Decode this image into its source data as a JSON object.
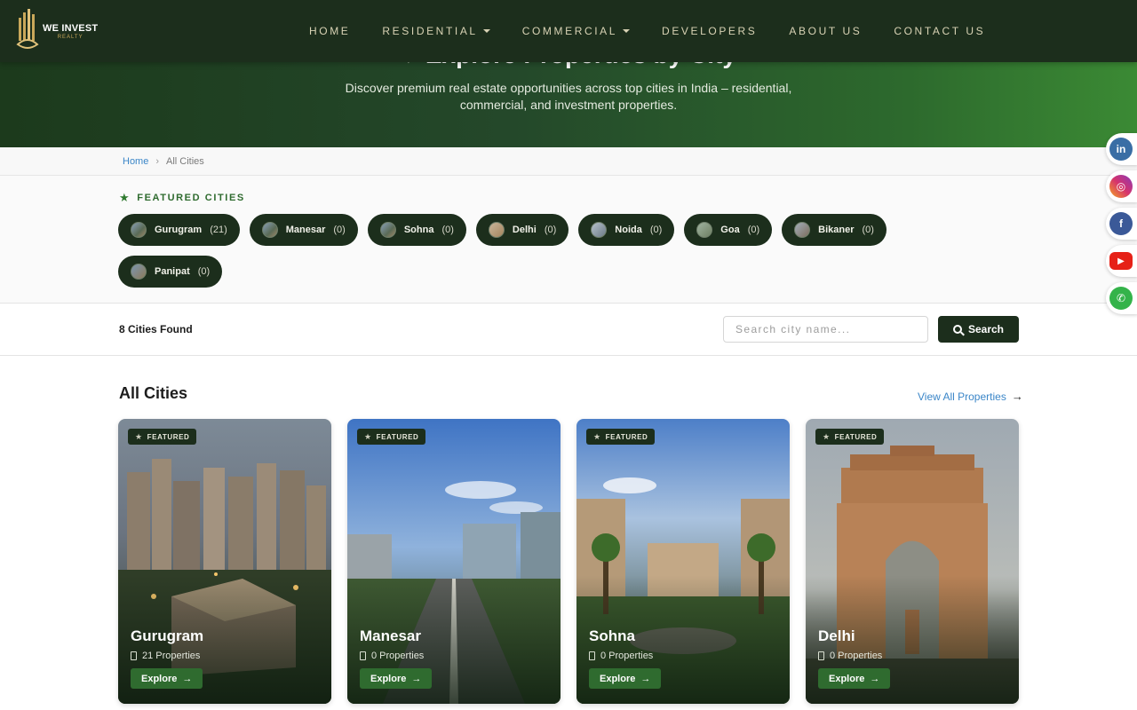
{
  "brand": {
    "name": "WE INVEST",
    "tagline": "REALTY"
  },
  "nav": {
    "items": [
      {
        "label": "HOME",
        "dropdown": false
      },
      {
        "label": "RESIDENTIAL",
        "dropdown": true
      },
      {
        "label": "COMMERCIAL",
        "dropdown": true
      },
      {
        "label": "DEVELOPERS",
        "dropdown": false
      },
      {
        "label": "ABOUT US",
        "dropdown": false
      },
      {
        "label": "CONTACT US",
        "dropdown": false
      }
    ]
  },
  "hero": {
    "title": "Explore Properties by City",
    "subtitle": "Discover premium real estate opportunities across top cities in India – residential, commercial, and investment properties."
  },
  "breadcrumb": {
    "home": "Home",
    "separator": "›",
    "current": "All Cities"
  },
  "featured": {
    "label": "FEATURED CITIES",
    "chips": [
      {
        "name": "Gurugram",
        "count": "(21)"
      },
      {
        "name": "Manesar",
        "count": "(0)"
      },
      {
        "name": "Sohna",
        "count": "(0)"
      },
      {
        "name": "Delhi",
        "count": "(0)"
      },
      {
        "name": "Noida",
        "count": "(0)"
      },
      {
        "name": "Goa",
        "count": "(0)"
      },
      {
        "name": "Bikaner",
        "count": "(0)"
      },
      {
        "name": "Panipat",
        "count": "(0)"
      }
    ]
  },
  "search": {
    "found": "8 Cities Found",
    "placeholder": "Search city name...",
    "button": "Search"
  },
  "all_cities": {
    "title": "All Cities",
    "view_all": "View All Properties",
    "cards": [
      {
        "badge": "FEATURED",
        "name": "Gurugram",
        "count": "21 Properties",
        "cta": "Explore"
      },
      {
        "badge": "FEATURED",
        "name": "Manesar",
        "count": "0 Properties",
        "cta": "Explore"
      },
      {
        "badge": "FEATURED",
        "name": "Sohna",
        "count": "0 Properties",
        "cta": "Explore"
      },
      {
        "badge": "FEATURED",
        "name": "Delhi",
        "count": "0 Properties",
        "cta": "Explore"
      }
    ]
  },
  "social": [
    {
      "icon": "linkedin-icon",
      "glyph": "in",
      "color": "#3a6ea5"
    },
    {
      "icon": "instagram-icon",
      "glyph": "◎",
      "color": "#d6336c"
    },
    {
      "icon": "facebook-icon",
      "glyph": "f",
      "color": "#3b5998"
    },
    {
      "icon": "youtube-icon",
      "glyph": "▶",
      "color": "#e62117"
    },
    {
      "icon": "whatsapp-icon",
      "glyph": "✆",
      "color": "#34b34a"
    }
  ],
  "colors": {
    "nav_bg": "#1c2e1c",
    "accent_green": "#2f6b2f",
    "link_blue": "#3b86c8"
  }
}
